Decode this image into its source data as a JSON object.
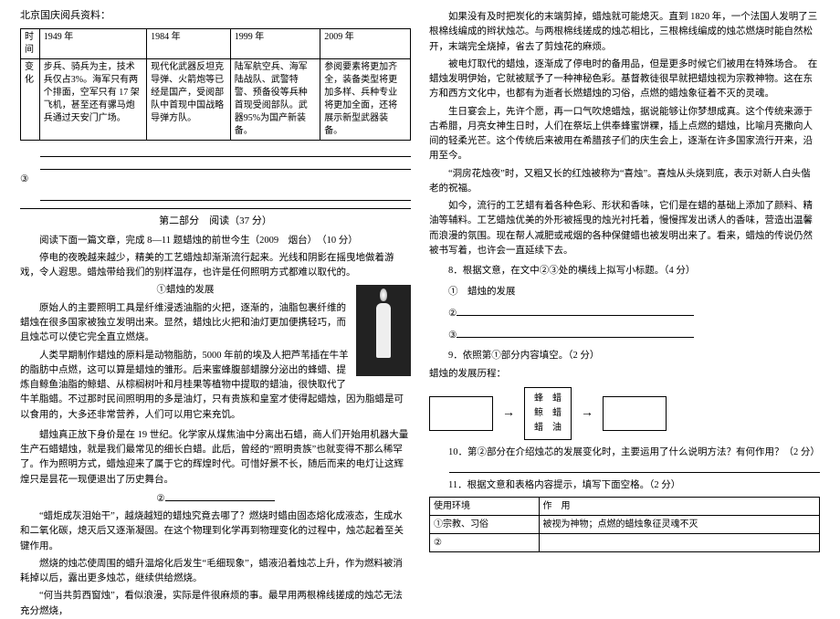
{
  "left": {
    "top_note": "北京国庆阅兵资料：",
    "table": {
      "r1c1": "时间",
      "r1c2": "1949 年",
      "r1c3": "1984 年",
      "r1c4": "1999 年",
      "r1c5": "2009 年",
      "r2c1": "变化",
      "r2c2": "步兵、骑兵为主，技术兵仅占3%。海军只有两个排面，空军只有 17 架飞机，甚至还有骡马炮兵通过天安门广场。",
      "r2c3": "现代化武器反坦克导弹、火箭炮等已经是国产，受阅部队中首现中国战略导弹方队。",
      "r2c4": "陆军航空兵、海军陆战队、武警特警、预备役等兵种首现受阅部队。武器95%为国产新装备。",
      "r2c5": "参阅要素将更加齐全，装备类型将更加多样、兵种专业将更加全面，还将展示新型武器装备。"
    },
    "ans_head": "③",
    "part_title": "第二部分　阅读（37 分）",
    "read_intro": "阅读下面一篇文章，完成 8—11 题蜡烛的前世今生（2009　烟台）　（10 分）",
    "p1": "停电的夜晚越来越少，精美的工艺蜡烛却渐渐流行起来。光线和阴影在摇曳地做着游戏，令人遐思。蜡烛带给我们的别样温存，也许是任何照明方式都难以取代的。",
    "sec1": "①蜡烛的发展",
    "p2": "原始人的主要照明工具是纤维浸透油脂的火把，逐渐的，油脂包裹纤维的蜡烛在很多国家被独立发明出来。显然，蜡烛比火把和油灯更加便携轻巧，而且烛芯可以使它完全直立燃烧。",
    "p3": "人类早期制作蜡烛的原料是动物脂肪，5000 年前的埃及人把芦苇插在牛羊的脂肪中点燃，这可以算是蜡烛的雏形。后来蜜蜂腹部蜡腺分泌出的蜂蜡、提炼自鲸鱼油脂的鲸蜡、从棕榈树叶和月桂果等植物中提取的蜡油，很快取代了牛羊脂蜡。不过那时民间照明用的多是油灯，只有贵族和皇室才使得起蜡烛，因为脂蜡是可以食用的，大多还非常营养，人们可以用它来充饥。",
    "p4": "蜡烛真正放下身价是在 19 世纪。化学家从煤焦油中分离出石蜡，商人们开始用机器大量生产石蜡蜡烛，就是我们最常见的细长白蜡。此后，曾经的“照明贵族”也就变得不那么稀罕了。作为照明方式，蜡烛迎来了属于它的辉煌时代。可惜好景不长，随后而来的电灯让这辉煌只是昙花一现便退出了历史舞台。",
    "sec2": "②",
    "p5": "“蜡炬成灰泪始干”，越烧越短的蜡烛究竟去哪了？燃烧时蜡由固态熔化成液态，生成水和二氧化碳，熄灭后又逐渐凝固。在这个物理到化学再到物理变化的过程中，烛芯起着至关键作用。",
    "p6": "燃烧的烛芯使周围的蜡升温熔化后发生“毛细现象”，蜡液沿着烛芯上升，作为燃料被消耗掉以后，露出更多烛芯，继续供给燃烧。",
    "p7": "“何当共剪西窗烛”，看似浪漫，实际是件很麻烦的事。最早用两根棉线搓成的烛芯无法充分燃烧，"
  },
  "right": {
    "p8": "如果没有及时把炭化的末端剪掉，蜡烛就可能熄灭。直到 1820 年，一个法国人发明了三根棉线编成的辫状烛芯。与两根棉线搓成的烛芯相比，三根棉线编成的烛芯燃烧时能自然松开，末端完全烧掉，省去了剪烛花的麻烦。",
    "p9": "被电灯取代的蜡烛，逐渐成了停电时的备用品，但是更多时候它们被用在特殊场合。　在蜡烛发明伊始，它就被赋予了一种神秘色彩。基督教徒很早就把蜡烛视为宗教神物。这在东方和西方文化中，也都有为逝者长燃蜡烛的习俗，点燃的蜡烛象征着不灭的灵魂。",
    "p10": "生日宴会上，先许个愿，再一口气吹熄蜡烛，据说能够让你梦想成真。这个传统来源于古希腊，月亮女神生日时，人们在祭坛上供奉蜂蜜饼粿，插上点燃的蜡烛，比喻月亮撒向人间的轻柔光芒。这个传统后来被用在希腊孩子们的庆生会上，逐渐在许多国家流行开来，沿用至今。",
    "p11": "“洞房花烛夜”时，又粗又长的红烛被称为“喜烛”。喜烛从头烧到底，表示对新人白头偕老的祝福。",
    "p12": "如今，流行的工艺蜡有着各种色彩、形状和香味，它们是在蜡的基础上添加了颜料、精油等辅料。工艺蜡烛优美的外形被摇曳的烛光衬托着，慢慢挥发出诱人的香味，营造出温馨而浪漫的氛围。现在帮人减肥或戒烟的各种保健蜡也被发明出来了。看来，蜡烛的传说仍然被书写着，也许会一直延续下去。",
    "q8": "8．根据文意，在文中②③处的横线上拟写小标题。（4 分）",
    "q8_1": "①　蜡烛的发展",
    "q8_2": "②",
    "q8_3": "③",
    "q9": "9．依照第①部分内容填空。（2 分）",
    "q9_label": "蜡烛的发展历程：",
    "diagram": {
      "r1": "蜂　蜡",
      "r2": "鲸　蜡",
      "r3": "蜡　油"
    },
    "q10": "10．第②部分在介绍烛芯的发展变化时，主要运用了什么说明方法？有何作用？（2 分）",
    "q11": "11．根据文意和表格内容提示，填写下面空格。（2 分）",
    "table2": {
      "h1": "使用环境",
      "h2": "作　用",
      "r1c1": "①宗教、习俗",
      "r1c2": "被视为神物；点燃的蜡烛象征灵魂不灭",
      "r2c1": "②",
      "r2c2": ""
    }
  },
  "chart_data": [
    {
      "type": "table",
      "title": "北京国庆阅兵资料",
      "columns": [
        "时间",
        "1949 年",
        "1984 年",
        "1999 年",
        "2009 年"
      ],
      "rows": [
        [
          "变化",
          "步兵、骑兵为主，技术兵仅占3%。海军只有两个排面，空军只有17架飞机，甚至还有骡马炮兵通过天安门广场。",
          "现代化武器反坦克导弹、火箭炮等已经是国产，受阅部队中首现中国战略导弹方队。",
          "陆军航空兵、海军陆战队、武警特警、预备役等兵种首现受阅部队。武器95%为国产新装备。",
          "参阅要素将更加齐全，装备类型将更加多样、兵种专业将更加全面，还将展示新型武器装备。"
        ]
      ]
    },
    {
      "type": "table",
      "title": "问题11表格",
      "columns": [
        "使用环境",
        "作用"
      ],
      "rows": [
        [
          "①宗教、习俗",
          "被视为神物；点燃的蜡烛象征灵魂不灭"
        ],
        [
          "②",
          ""
        ]
      ]
    }
  ]
}
